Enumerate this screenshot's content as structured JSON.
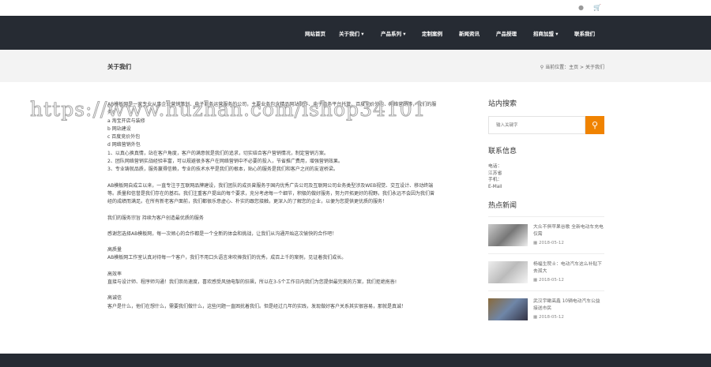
{
  "topbar": {
    "user_icon": "user-icon",
    "cart_icon": "cart-icon"
  },
  "nav": [
    "网站首页",
    "关于我们 ▾",
    "产品系列 ▾",
    "定制案例",
    "新闻资讯",
    "产品授理",
    "招商加盟 ▾",
    "联系我们"
  ],
  "band": {
    "title": "关于我们",
    "crumb_prefix": "当前位置：",
    "crumb_home": "主页",
    "crumb_sep": " > ",
    "crumb_current": "关于我们"
  },
  "watermark": "https://www.huzhan.com/ishop34101",
  "main": {
    "intro": "AB模板网是一家专业从事企业营销策划、电子商务运营服务的公司，主要业务包含精品网站制作、电子商务平台托管、百度竞价外包、网络营销等，我们的服务：",
    "services": [
      "a  淘宝开店与装修",
      "b  网站建设",
      "c  百度竞价外包",
      "d  网络营销外包"
    ],
    "points": [
      "1、以真心换真情，站在客户角度，客户的满意就是我们的追求，切实结合客户营销情况，制定营销方案。",
      "2、团队网络营销实战经验丰富，可以规避很多客户在网络营销中不必要的投入，节省推广费用，增强营销效果。",
      "3、专业铸就品质，服务赢得信赖，专业的技术水平是我们的根本，贴心的服务是我们和客户之间的友谊桥梁。"
    ],
    "para2": "AB模板网自成立以来，一直专注于互联网品牌建设，我们团队的成员曾服务于国内优秀广告公司及互联网公司业务类型涉及WEB视觉、交互设计、移动终端等。质量和信誉是我们存在的基石。我们注重客户提出的每个要求，充分考虑每一个细节，积极的做好服务，努力开拓更好的视野。我们永远不会因为我们曾经的成绩而满足。在所有新老客户面前，我们都很乐意虚心、朴实的跟您接触，更深入的了解您的企业，以便为您提供更优质的服务！",
    "tagline": "我们的服务宗旨 持续为客户创造最优质的服务",
    "thanks": "感谢您选择AB模板网，每一次倾心的合作都是一个全新的体会和挑战，让我们从沟通开始这次愉快的合作吧！",
    "sections": [
      {
        "title": "高质量",
        "text": "AB模板网工作室认真对待每一个客户，我们不用口头语言来吹捧我们的优秀，成百上千的案例，见证着我们成长。"
      },
      {
        "title": "高效率",
        "text": "直接与设计师、程序师沟通！我们崇尚速度，喜欢感受风驰电掣的狂飙，所以在3-5个工作日内我们为您提供最完美的方案，我们拒绝拖沓!"
      },
      {
        "title": "高诚信",
        "text": "客户是什么，他们在想什么，需要我们做什么，这些问题一直困扰着我们。但是经过几年的实践，发现做好客户关系其实很容易，那就是真诚！"
      }
    ]
  },
  "side": {
    "search_title": "站内搜索",
    "search_placeholder": "输入关键字",
    "contact_title": "联系信息",
    "contact": [
      "电话：",
      "江苏省",
      "手机：",
      "E-Mail"
    ],
    "news_title": "热点新闻",
    "news": [
      {
        "title": "大众不俱苹果谷歌 全新电动车充电仅需",
        "date": "2018-05-12"
      },
      {
        "title": "杨福生院士：电动汽车这么补贴下去孤大",
        "date": "2018-05-12"
      },
      {
        "title": "武汉宇瞰高鑫 10辆电动汽车公益接送市民",
        "date": "2018-05-12"
      }
    ]
  }
}
